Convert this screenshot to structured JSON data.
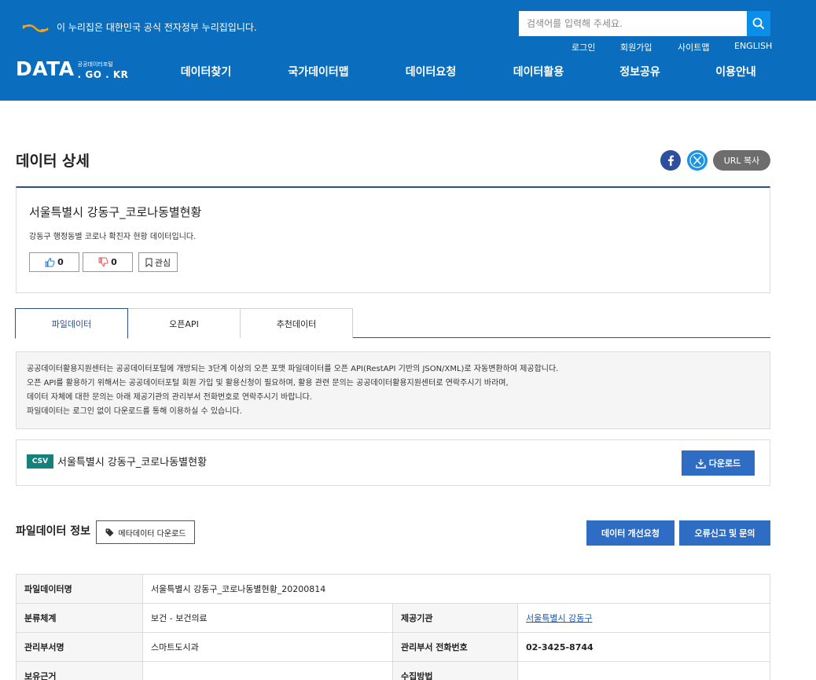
{
  "header": {
    "gov_notice": "이 누리집은 대한민국 공식 전자정부 누리집입니다.",
    "search": {
      "placeholder": "검색어를 입력해 주세요.",
      "value": ""
    },
    "util_links": [
      "로그인",
      "회원가입",
      "사이트맵",
      "ENGLISH"
    ],
    "logo": {
      "main": "DATA",
      "sub_top": "공공데이터포털",
      "sub_bottom": ". GO . KR"
    },
    "nav": [
      "데이터찾기",
      "국가데이터맵",
      "데이터요청",
      "데이터활용",
      "정보공유",
      "이용안내"
    ]
  },
  "page": {
    "title": "데이터 상세",
    "url_copy": "URL 복사"
  },
  "summary": {
    "title": "서울특별시 강동구_코로나동별현황",
    "description": "강동구 행정동별 코로나 확진자 현황 데이터입니다.",
    "likes": "0",
    "dislikes": "0",
    "favorite": "관심"
  },
  "tabs": [
    "파일데이터",
    "오픈API",
    "추천데이터"
  ],
  "notice": [
    "공공데이터활용지원센터는 공공데이터포털에 개방되는 3단계 이상의 오픈 포맷 파일데이터를 오픈 API(RestAPI 기반의 JSON/XML)로 자동변환하여 제공합니다.",
    "오픈 API를 활용하기 위해서는 공공데이터포털 회원 가입 및 활용신청이 필요하며, 활용 관련 문의는 공공데이터활용지원센터로 연락주시기 바라며,",
    "데이터 자체에 대한 문의는 아래 제공기관의 관리부서 전화번호로 연락주시기 바랍니다.",
    "파일데이터는 로그인 없이 다운로드를 통해 이용하실 수 있습니다."
  ],
  "file": {
    "format": "CSV",
    "name": "서울특별시 강동구_코로나동별현황",
    "download": "다운로드"
  },
  "info": {
    "title": "파일데이터 정보",
    "meta_download": "메타데이터 다운로드",
    "improve_request": "데이터 개선요청",
    "error_report": "오류신고 및 문의",
    "rows": {
      "file_name_label": "파일데이터명",
      "file_name_value": "서울특별시 강동구_코로나동별현황_20200814",
      "category_label": "분류체계",
      "category_value": "보건 - 보건의료",
      "provider_label": "제공기관",
      "provider_value": "서울특별시 강동구",
      "dept_label": "관리부서명",
      "dept_value": "스마트도시과",
      "dept_phone_label": "관리부서 전화번호",
      "dept_phone_value": "02-3425-8744",
      "basis_label": "보유근거",
      "basis_value": "",
      "collect_label": "수집방법",
      "collect_value": ""
    }
  },
  "colors": {
    "header_bg": "#0b6dbd",
    "primary_button": "#2f6dc4",
    "csv_badge": "#16807a",
    "tab_accent": "#2f4f8a"
  }
}
